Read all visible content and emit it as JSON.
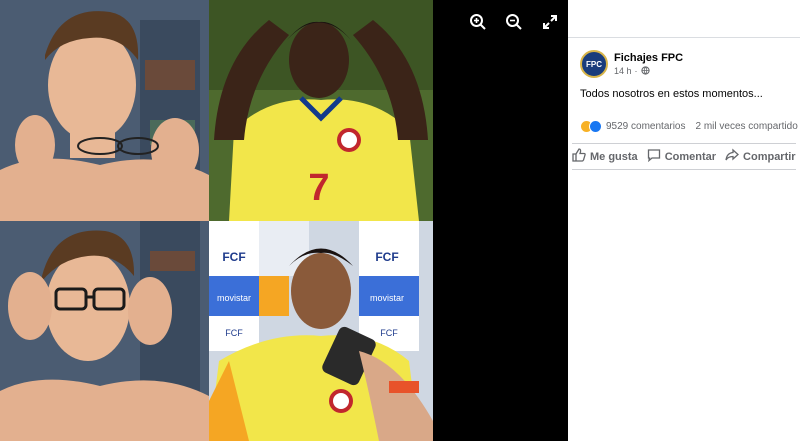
{
  "post": {
    "author": "Fichajes FPC",
    "avatar_text": "FPC",
    "time": "14 h",
    "privacy_icon": "globe-icon",
    "text": "Todos nosotros en estos momentos...",
    "comments": "9529 comentarios",
    "shares": "2 mil veces compartido",
    "reactions": [
      "haha-icon",
      "like-icon"
    ]
  },
  "actions": {
    "like": "Me gusta",
    "comment": "Comentar",
    "share": "Compartir"
  },
  "image": {
    "panels": [
      {
        "jersey_number": "7"
      },
      {
        "sponsor_texts": [
          "FCF",
          "FCF",
          "movistar",
          "FCF",
          "movistar",
          "FCF"
        ]
      }
    ]
  },
  "viewer_tools": [
    "zoom-in-icon",
    "zoom-out-icon",
    "fullscreen-icon"
  ],
  "colors": {
    "viewer_bg": "#000000",
    "jersey_yellow": "#f2e64a",
    "jersey_blue": "#123a8c",
    "brand_blue": "#1877f2"
  }
}
